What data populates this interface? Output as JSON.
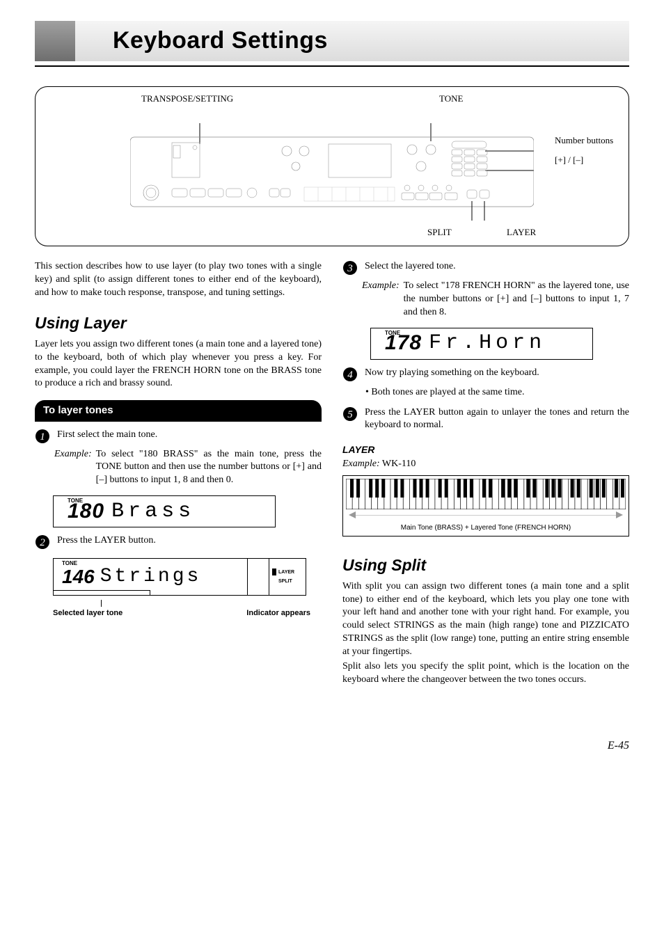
{
  "page_title": "Keyboard Settings",
  "diagram": {
    "labels": {
      "transpose": "TRANSPOSE/SETTING",
      "tone": "TONE",
      "number_buttons": "Number buttons",
      "plus_minus": "[+] / [–]",
      "split": "SPLIT",
      "layer": "LAYER"
    }
  },
  "intro": "This section describes how to use layer (to play two tones with a single key) and split (to assign different tones to either end of the keyboard), and how to make touch response, transpose, and tuning settings.",
  "layer": {
    "heading": "Using Layer",
    "desc": "Layer lets you assign two different tones (a main tone and a layered tone) to the keyboard, both of which play whenever you press a key. For example, you could layer the FRENCH HORN tone on the BRASS tone to produce a rich and brassy sound.",
    "sub_heading": "To layer tones",
    "step1": "First select the main tone.",
    "step1_example_label": "Example:",
    "step1_example": "To select \"180 BRASS\" as the main tone, press the TONE button and then use the number buttons or [+] and [–] buttons to input 1, 8 and then 0.",
    "lcd1": {
      "tone_label": "TONE",
      "digits": "180",
      "text": "Brass"
    },
    "step2": "Press the LAYER button.",
    "lcd2": {
      "tone_label": "TONE",
      "digits": "146",
      "text": "Strings",
      "ind_layer": "LAYER",
      "ind_split": "SPLIT"
    },
    "lcd2_caption_left": "Selected layer tone",
    "lcd2_caption_right": "Indicator appears",
    "step3": "Select the layered tone.",
    "step3_example_label": "Example:",
    "step3_example": "To select \"178 FRENCH HORN\" as the layered tone, use the number buttons or [+] and [–] buttons to input 1, 7 and then 8.",
    "lcd3": {
      "tone_label": "TONE",
      "digits": "178",
      "text": "Fr.Horn"
    },
    "step4": "Now try playing something on the keyboard.",
    "step4_bullet": "• Both tones are played at the same time.",
    "step5": "Press the LAYER button again to unlayer the tones and return the keyboard to normal.",
    "layer_sub": "LAYER",
    "layer_ex_label": "Example:",
    "layer_ex": "WK-110",
    "piano_caption": "Main Tone (BRASS) + Layered Tone (FRENCH HORN)"
  },
  "split": {
    "heading": "Using Split",
    "desc1": "With split you can assign two different tones (a main tone and a split tone) to either end of the keyboard, which lets you play one tone with your left hand and another tone with your right hand. For example, you could select STRINGS as the main (high range) tone and PIZZICATO STRINGS as the split (low range) tone, putting an entire string ensemble at your fingertips.",
    "desc2": "Split also lets you specify the split point, which is the location on the keyboard where the changeover between the two tones occurs."
  },
  "page_num": "E-45"
}
